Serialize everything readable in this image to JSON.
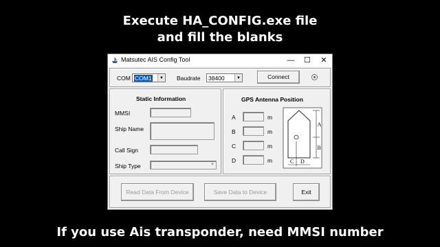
{
  "captions": {
    "top_line1": "Execute HA_CONFIG.exe file",
    "top_line2": "and fill the blanks",
    "bottom": "If you use Ais transponder, need MMSI number"
  },
  "window": {
    "title": "Matsutec AIS Config Tool",
    "min_glyph": "—",
    "max_glyph": "☐",
    "close_glyph": "✕"
  },
  "connection": {
    "com_label": "COM",
    "com_value": "COM1",
    "baud_label": "Baudrate",
    "baud_value": "38400",
    "connect_label": "Connect",
    "dropdown_glyph": "▼"
  },
  "static_info": {
    "title": "Static Information",
    "mmsi_label": "MMSI",
    "ship_name_label": "Ship Name",
    "call_sign_label": "Call Sign",
    "ship_type_label": "Ship Type"
  },
  "gps": {
    "title": "GPS Antenna Position",
    "rows": [
      {
        "label": "A",
        "unit": "m"
      },
      {
        "label": "B",
        "unit": "m"
      },
      {
        "label": "C",
        "unit": "m"
      },
      {
        "label": "D",
        "unit": "m"
      }
    ],
    "diagram_labels": {
      "a": "A",
      "b": "B",
      "c": "C",
      "d": "D"
    }
  },
  "actions": {
    "read_label": "Read Data From Device",
    "save_label": "Save Data to Device",
    "exit_label": "Exit"
  }
}
